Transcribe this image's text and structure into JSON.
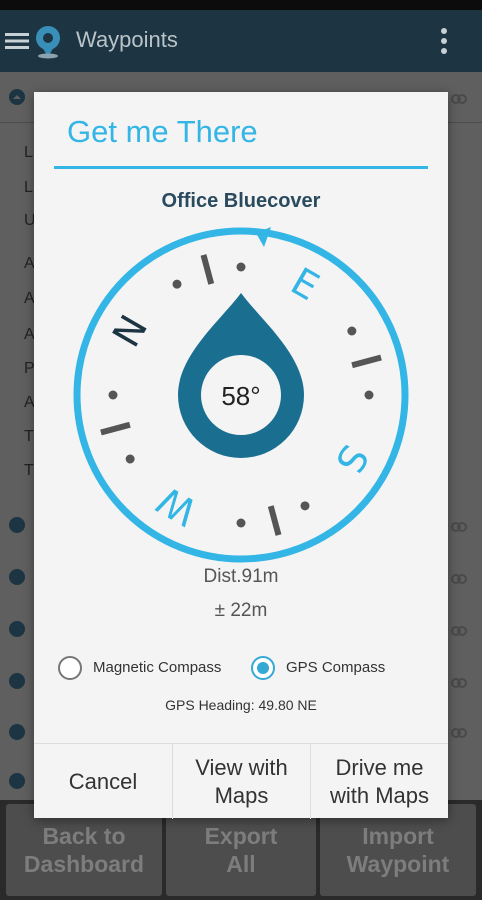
{
  "app": {
    "title": "Waypoints",
    "icons": {
      "menu": "hamburger-icon",
      "logo": "globe-pin-icon",
      "overflow": "overflow-dots-icon"
    }
  },
  "background_list": {
    "side_letters": [
      "L",
      "L",
      "U",
      "A",
      "A",
      "A",
      "P",
      "A",
      "T",
      "T"
    ]
  },
  "bottom_bar": {
    "back": "Back to\nDashboard",
    "export": "Export\nAll",
    "import": "Import\nWaypoint"
  },
  "dialog": {
    "title": "Get me There",
    "waypoint_name": "Office Bluecover",
    "compass": {
      "heading_label": "58°",
      "cardinals": [
        "N",
        "E",
        "S",
        "W"
      ],
      "heading_degrees": 58,
      "colors": {
        "ring": "#33b5e5",
        "needle": "#1a6f91",
        "ticks": "#555555"
      }
    },
    "distance": "Dist.91m",
    "accuracy": "± 22m",
    "options": {
      "magnetic": {
        "label": "Magnetic Compass",
        "checked": false
      },
      "gps": {
        "label": "GPS Compass",
        "checked": true
      }
    },
    "gps_heading": "GPS Heading: 49.80 NE",
    "buttons": {
      "cancel": "Cancel",
      "view_maps": "View with\nMaps",
      "drive_maps": "Drive me\nwith Maps"
    }
  }
}
